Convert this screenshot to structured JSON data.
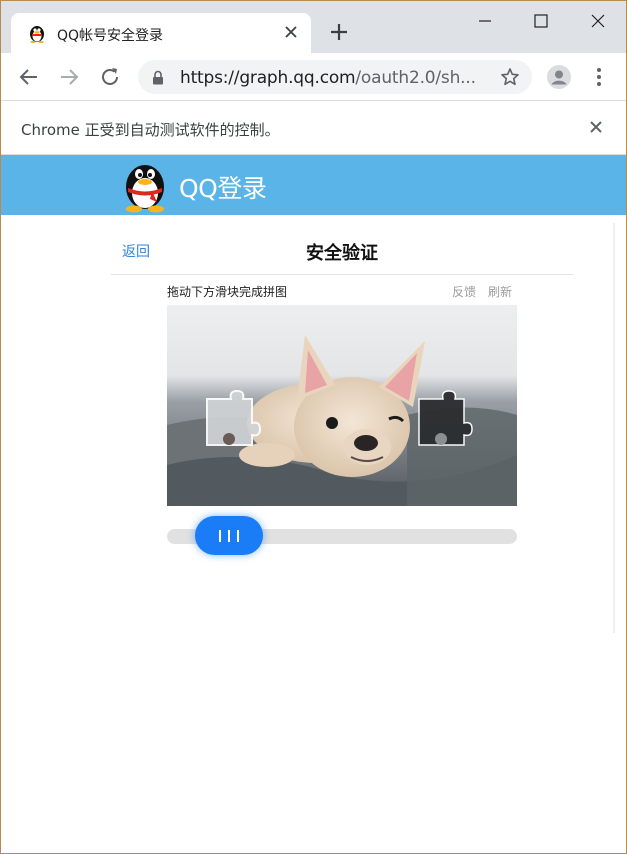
{
  "browser": {
    "tab_title": "QQ帐号安全登录",
    "new_tab_label": "+",
    "url_host": "https://graph.qq.com",
    "url_path": "/oauth2.0/sh...",
    "infobar_message": "Chrome 正受到自动测试软件的控制。"
  },
  "header": {
    "title": "QQ登录"
  },
  "verify": {
    "back_label": "返回",
    "title": "安全验证"
  },
  "captcha": {
    "instruction": "拖动下方滑块完成拼图",
    "feedback_label": "反馈",
    "refresh_label": "刷新",
    "slider_position": 0.08,
    "grip_symbol": "III"
  },
  "colors": {
    "header_bg": "#5ab4e8",
    "link": "#2f86d8",
    "slider_handle": "#1a7cf6",
    "slider_track": "#e1e1e1"
  },
  "icons": [
    "qq-penguin-icon",
    "close-icon",
    "plus-icon",
    "minimize-icon",
    "maximize-icon",
    "back-arrow-icon",
    "forward-arrow-icon",
    "reload-icon",
    "lock-icon",
    "star-icon",
    "profile-icon",
    "kebab-menu-icon"
  ]
}
